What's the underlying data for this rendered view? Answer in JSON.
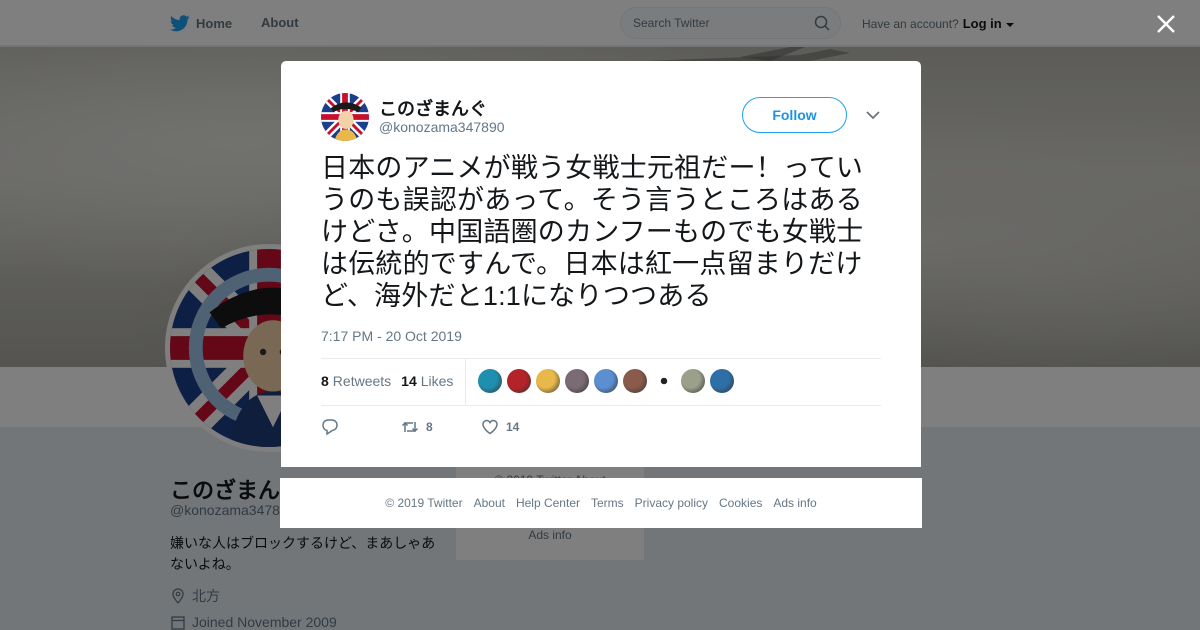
{
  "nav": {
    "home": "Home",
    "about": "About",
    "search_placeholder": "Search Twitter",
    "have_account": "Have an account?",
    "login": "Log in"
  },
  "profile": {
    "name": "このざまんぐ",
    "handle": "@konozama3478",
    "bio": "嫌いな人はブロックするけど、まあしゃあないよね。",
    "location": "北方",
    "joined": "Joined November 2009",
    "sidebar_copyright": "© 2019 Twitter  About",
    "sidebar_ads": "Ads info"
  },
  "tweet": {
    "author_name": "このざまんぐ",
    "author_handle": "@konozama347890",
    "follow_label": "Follow",
    "text": "日本のアニメが戦う女戦士元祖だー！っていうのも誤認があって。そう言うところはあるけどさ。中国語圏のカンフーものでも女戦士は伝統的ですんで。日本は紅一点留まりだけど、海外だと1:1になりつつある",
    "timestamp": "7:17 PM - 20 Oct 2019",
    "retweets_count": "8",
    "retweets_label": "Retweets",
    "likes_count": "14",
    "likes_label": "Likes",
    "action_retweets": "8",
    "action_likes": "14"
  },
  "likers": [
    {
      "icon": "liker-avatar",
      "color": "#1f8fb0"
    },
    {
      "icon": "liker-avatar",
      "color": "#b5232a"
    },
    {
      "icon": "liker-avatar",
      "color": "#e8b84a"
    },
    {
      "icon": "liker-avatar",
      "color": "#7a6b74"
    },
    {
      "icon": "liker-avatar",
      "color": "#5b8fcf"
    },
    {
      "icon": "liker-avatar",
      "color": "#8a5a4a"
    },
    {
      "icon": "liker-avatar",
      "color": "#ffffff"
    },
    {
      "icon": "liker-avatar",
      "color": "#9aa08a"
    },
    {
      "icon": "liker-avatar",
      "color": "#2f6fa8"
    }
  ],
  "footer": {
    "copyright": "© 2019 Twitter",
    "about": "About",
    "help": "Help Center",
    "terms": "Terms",
    "privacy": "Privacy policy",
    "cookies": "Cookies",
    "ads": "Ads info"
  },
  "colors": {
    "accent": "#1da1f2",
    "text": "#14171a",
    "muted": "#657786"
  }
}
